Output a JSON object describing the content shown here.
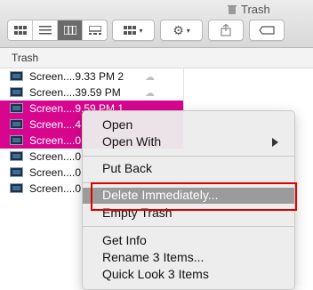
{
  "window": {
    "title": "Trash"
  },
  "header": {
    "label": "Trash"
  },
  "files": [
    {
      "name": "Screen....9.33 PM 2",
      "selected": false,
      "cloud": true
    },
    {
      "name": "Screen....39.59 PM",
      "selected": false,
      "cloud": true
    },
    {
      "name": "Screen....9.59 PM 1",
      "selected": true,
      "cloud": false
    },
    {
      "name": "Screen....4",
      "selected": true,
      "cloud": false
    },
    {
      "name": "Screen....0",
      "selected": true,
      "cloud": false
    },
    {
      "name": "Screen....0",
      "selected": false,
      "cloud": false
    },
    {
      "name": "Screen....0",
      "selected": false,
      "cloud": false
    },
    {
      "name": "Screen....0",
      "selected": false,
      "cloud": false
    }
  ],
  "context_menu": {
    "items": [
      {
        "label": "Open"
      },
      {
        "label": "Open With",
        "submenu": true
      },
      {
        "label": "Put Back"
      },
      {
        "label": "Delete Immediately...",
        "highlighted": true
      },
      {
        "label": "Empty Trash"
      },
      {
        "label": "Get Info"
      },
      {
        "label": "Rename 3 Items..."
      },
      {
        "label": "Quick Look 3 Items"
      }
    ]
  },
  "colors": {
    "selection": "#d8068f",
    "menu_highlight": "#9b9b9b",
    "annotation": "#e00000"
  }
}
